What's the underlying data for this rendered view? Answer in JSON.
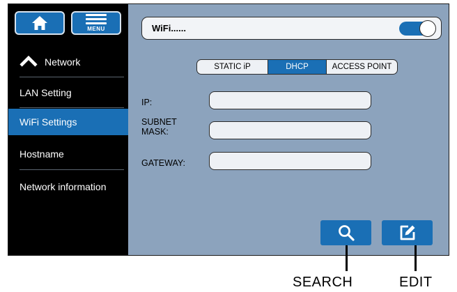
{
  "top_buttons": {
    "home_icon": "home-icon",
    "menu_label": "MENU"
  },
  "sidebar": {
    "items": [
      {
        "label": "Network",
        "icon": "chevron-up-icon"
      },
      {
        "label": "LAN Setting"
      },
      {
        "label": "WiFi Settings",
        "active": true
      },
      {
        "label": "Hostname"
      },
      {
        "label": "Network information"
      }
    ]
  },
  "wifi": {
    "label": "WiFi......",
    "toggle_on": true
  },
  "tabs": [
    {
      "label": "STATIC iP"
    },
    {
      "label": "DHCP",
      "active": true
    },
    {
      "label": "ACCESS POINT"
    }
  ],
  "fields": {
    "ip_label": "IP:",
    "subnet_label_1": "SUBNET",
    "subnet_label_2": "MASK:",
    "gateway_label": "GATEWAY:",
    "ip_value": "",
    "subnet_value": "",
    "gateway_value": ""
  },
  "actions": {
    "search_icon": "search-icon",
    "edit_icon": "edit-icon"
  },
  "callouts": {
    "search": "SEARCH",
    "edit": "EDIT"
  },
  "colors": {
    "accent": "#1a6fb5",
    "panel": "#8ca3bd",
    "sidebar": "#000000"
  }
}
